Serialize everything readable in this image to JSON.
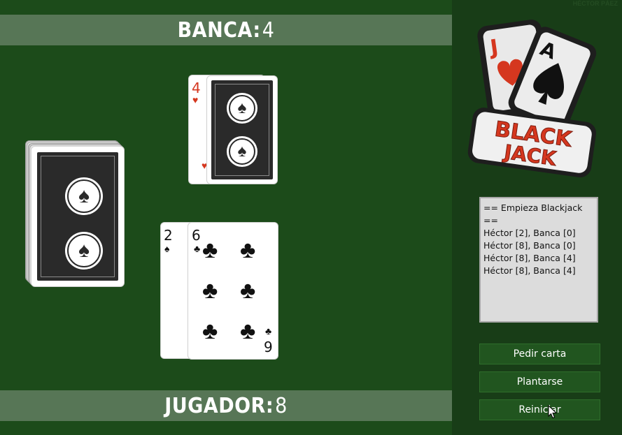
{
  "dealer": {
    "label": "BANCA:",
    "score": "4"
  },
  "player": {
    "label": "JUGADOR:",
    "score": "8"
  },
  "logo": {
    "top": "BLACK",
    "bottom": "JACK",
    "card1_rank": "J",
    "card2_rank": "A"
  },
  "author": "HÉCTOR PÁEZ",
  "log": {
    "lines": [
      "== Empieza Blackjack ==",
      "Héctor [2], Banca [0]",
      "Héctor [8], Banca [0]",
      "Héctor [8], Banca [4]",
      "Héctor [8], Banca [4]"
    ]
  },
  "buttons": {
    "hit": "Pedir carta",
    "stand": "Plantarse",
    "reset": "Reiniciar"
  },
  "dealer_cards": [
    {
      "rank": "4",
      "suit": "♥",
      "color": "#d5371f"
    }
  ],
  "player_cards": [
    {
      "rank": "2",
      "suit": "♠"
    },
    {
      "rank": "6",
      "suit": "♣",
      "rank_bottom": "9"
    }
  ],
  "colors": {
    "felt": "#1c4b1a",
    "panel": "#183d17",
    "banner": "#577656",
    "button": "#21551f",
    "accent_red": "#d5371f"
  }
}
